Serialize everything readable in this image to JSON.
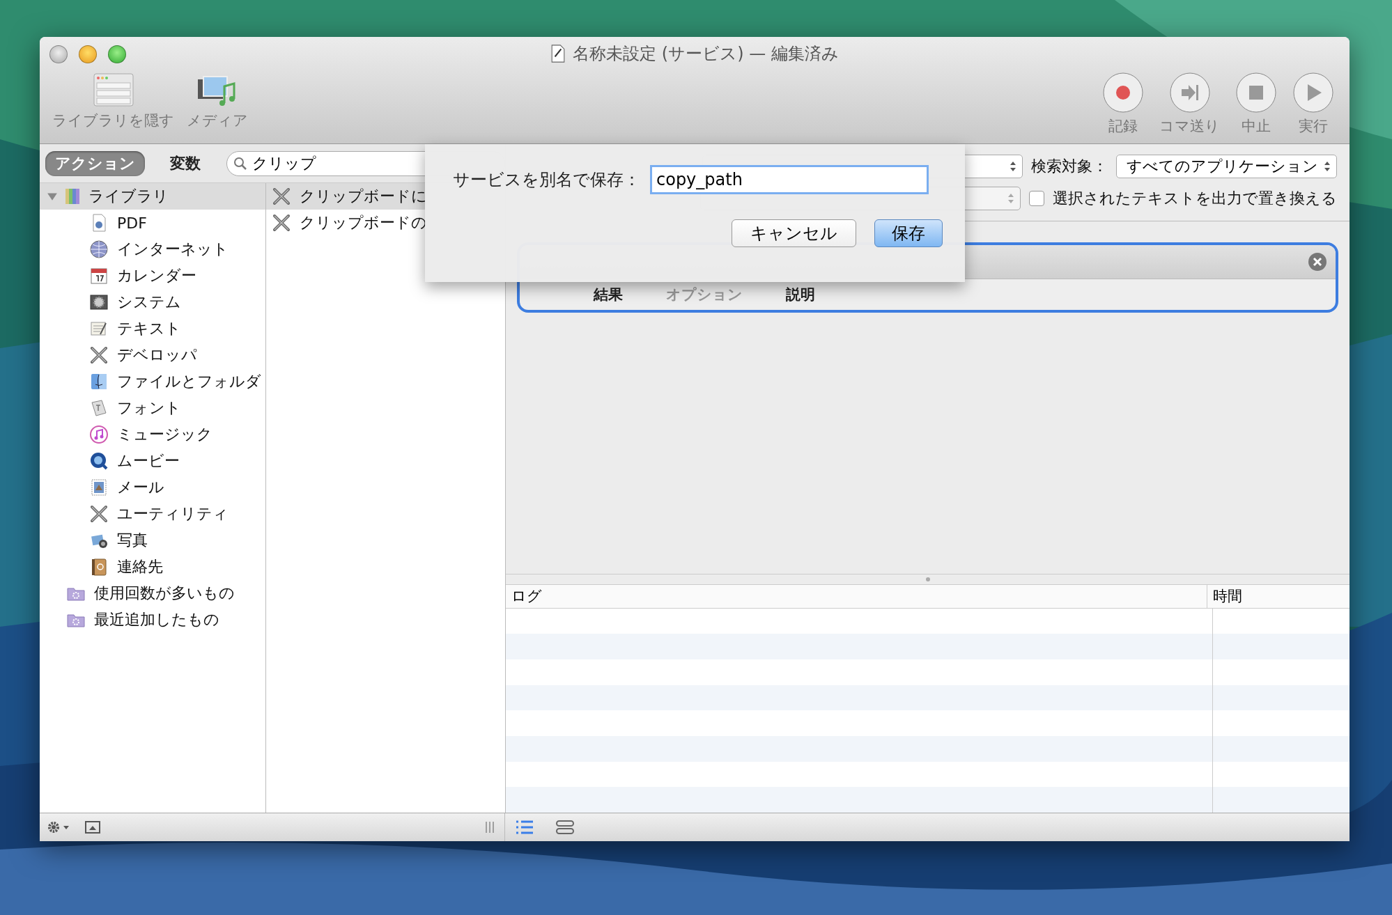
{
  "window": {
    "title": "名称未設定 (サービス) — 編集済み"
  },
  "toolbar": {
    "left": [
      {
        "kind": "library",
        "label": "ライブラリを隠す"
      },
      {
        "kind": "media",
        "label": "メディア"
      }
    ],
    "right": [
      {
        "kind": "record",
        "label": "記録"
      },
      {
        "kind": "step",
        "label": "コマ送り"
      },
      {
        "kind": "stop",
        "label": "中止"
      },
      {
        "kind": "run",
        "label": "実行"
      }
    ]
  },
  "library_tabs": [
    {
      "label": "アクション",
      "selected": true
    },
    {
      "label": "変数",
      "selected": false
    }
  ],
  "search": {
    "value": "クリップ"
  },
  "library": {
    "label": "ライブラリ",
    "expanded": true,
    "selected": true,
    "children": [
      {
        "kind": "pdf",
        "label": "PDF"
      },
      {
        "kind": "globe",
        "label": "インターネット"
      },
      {
        "kind": "calendar",
        "label": "カレンダー"
      },
      {
        "kind": "system",
        "label": "システム"
      },
      {
        "kind": "text",
        "label": "テキスト"
      },
      {
        "kind": "tools",
        "label": "デベロッパ"
      },
      {
        "kind": "finder",
        "label": "ファイルとフォルダ"
      },
      {
        "kind": "font",
        "label": "フォント"
      },
      {
        "kind": "music",
        "label": "ミュージック"
      },
      {
        "kind": "movie",
        "label": "ムービー"
      },
      {
        "kind": "mail",
        "label": "メール"
      },
      {
        "kind": "tools",
        "label": "ユーティリティ"
      },
      {
        "label": "写真"
      },
      {
        "kind": "contacts",
        "label": "連絡先"
      }
    ]
  },
  "smart_folders": [
    {
      "label": "使用回数が多いもの"
    },
    {
      "label": "最近追加したもの"
    }
  ],
  "actions": [
    {
      "label": "クリップボードに",
      "selected": true
    },
    {
      "label": "クリップボードの",
      "selected": false
    }
  ],
  "workflow_settings": {
    "search_target_label": "検索対象：",
    "search_target": "すべてのアプリケーション",
    "replace_checkbox": {
      "label": "選択されたテキストを出力で置き換える",
      "checked": false
    }
  },
  "action_card": {
    "tabs": [
      {
        "label": "結果",
        "disabled": false
      },
      {
        "label": "オプション",
        "disabled": true
      },
      {
        "label": "説明",
        "disabled": false
      }
    ]
  },
  "log": {
    "columns": [
      "ログ",
      "時間"
    ]
  },
  "sheet": {
    "label": "サービスを別名で保存：",
    "value": "copy_path",
    "buttons": [
      {
        "label": "キャンセル",
        "default": false
      },
      {
        "label": "保存",
        "default": true
      }
    ]
  }
}
